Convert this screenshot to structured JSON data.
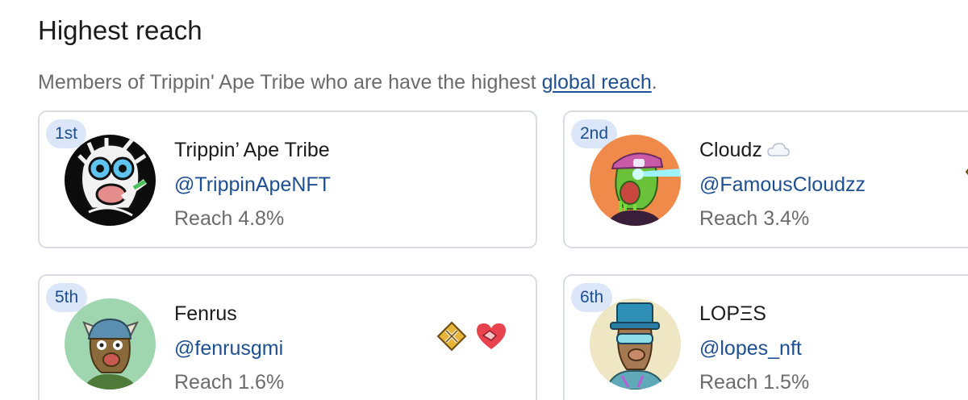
{
  "section": {
    "title": "Highest reach",
    "description_prefix": "Members of Trippin' Ape Tribe who are have the highest ",
    "description_link": "global reach",
    "description_suffix": "."
  },
  "members": [
    {
      "rank": "1st",
      "name": "Trippin’ Ape Tribe",
      "handle": "@TrippinApeNFT",
      "reach": "Reach 4.8%"
    },
    {
      "rank": "2nd",
      "name": "Cloudz",
      "name_icon": "cloud-icon",
      "handle": "@FamousCloudzz",
      "reach": "Reach 3.4%"
    },
    {
      "rank": "5th",
      "name": "Fenrus",
      "handle": "@fenrusgmi",
      "reach": "Reach 1.6%",
      "badges": [
        "tools-diamond-icon",
        "handshake-heart-icon"
      ]
    },
    {
      "rank": "6th",
      "name": "LOPΞS",
      "handle": "@lopes_nft",
      "reach": "Reach 1.5%"
    }
  ],
  "colors": {
    "link": "#1d4f91",
    "rank_bg": "#dbe7f8",
    "muted": "#6b6b6b",
    "border": "#d9dde3"
  }
}
